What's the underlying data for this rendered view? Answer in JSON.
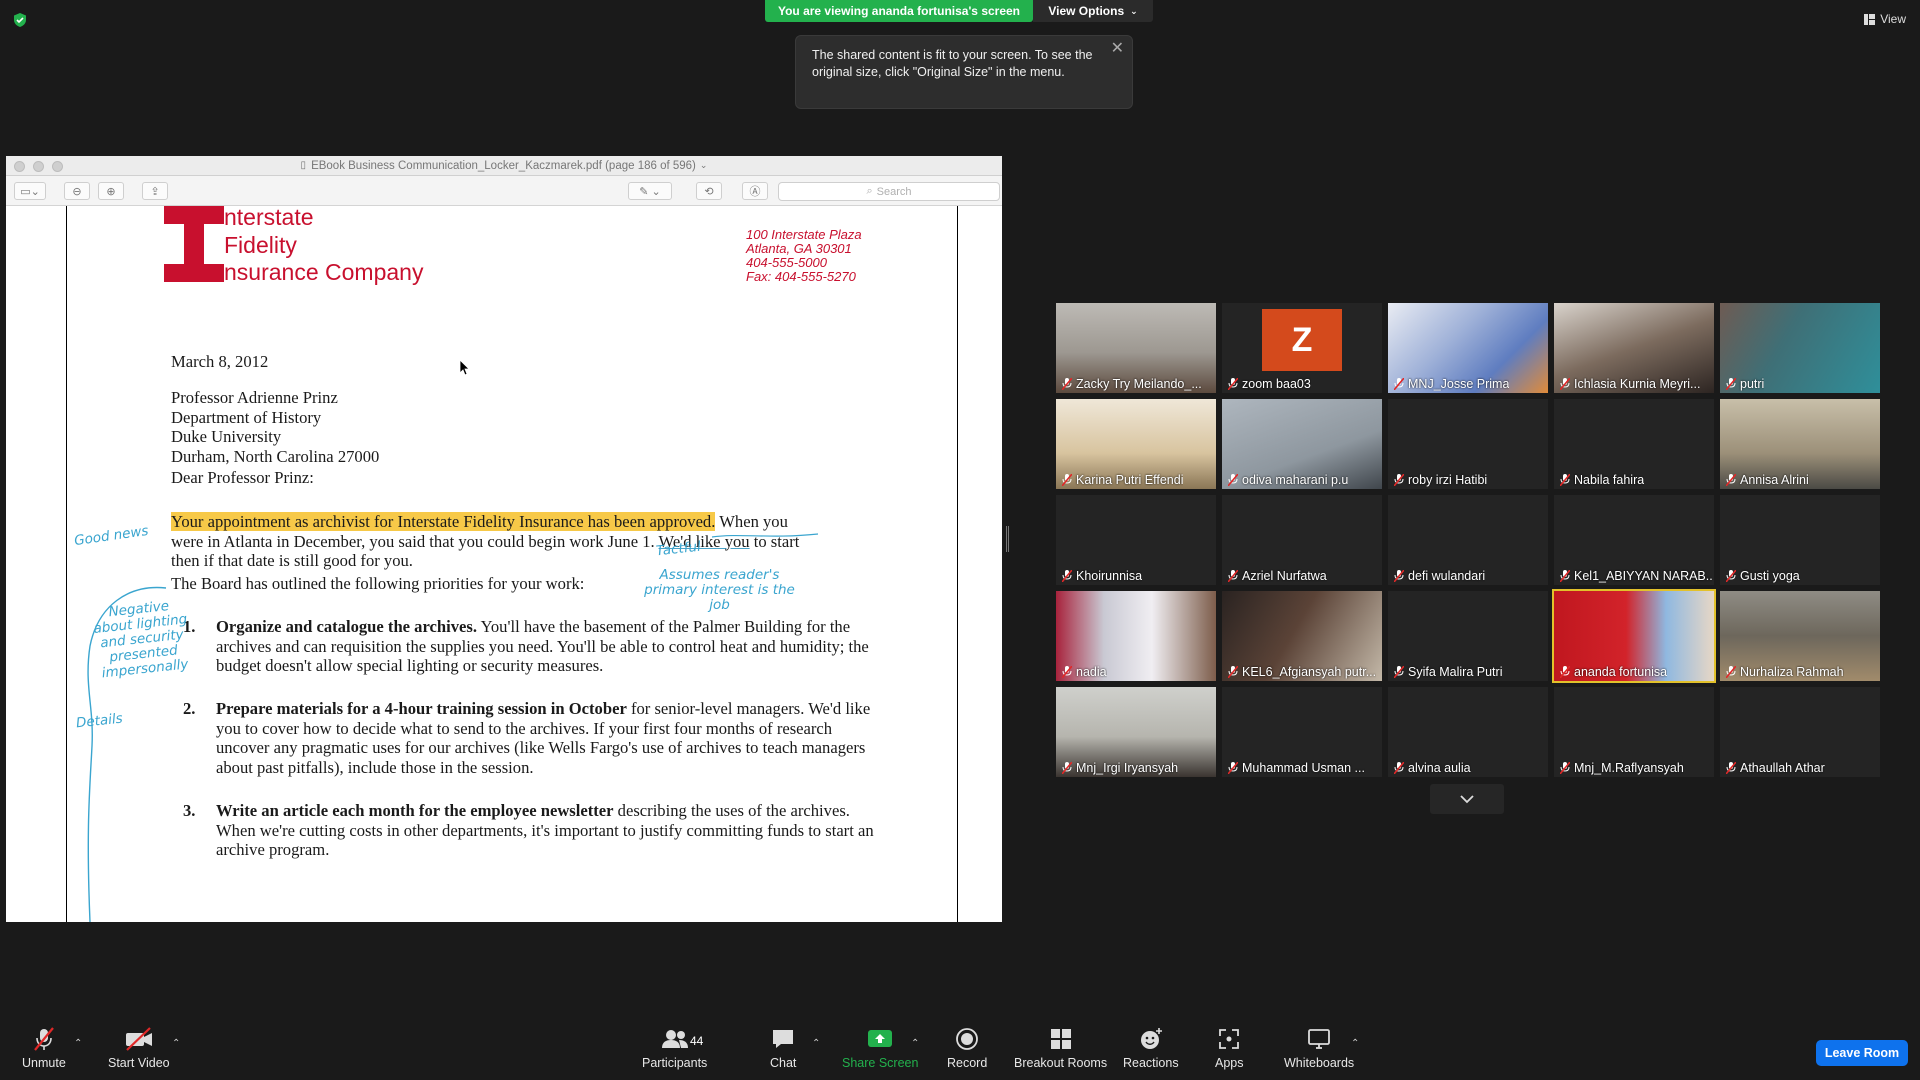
{
  "top": {
    "viewing_banner": "You are viewing ananda fortunisa's screen",
    "view_options": "View Options",
    "view_label": "View",
    "tooltip_text": "The shared content is fit to your screen. To see the original size, click \"Original Size\" in the menu."
  },
  "viewer": {
    "window_title": "EBook Business Communication_Locker_Kaczmarek.pdf (page 186 of 596)",
    "search_placeholder": "Search"
  },
  "letter": {
    "logo_line1": "nterstate",
    "logo_line2": "Fidelity",
    "logo_line3": "nsurance Company",
    "address1": "100 Interstate Plaza",
    "address2": "Atlanta, GA 30301",
    "address3": "404-555-5000",
    "address4": "Fax:  404-555-5270",
    "date": "March 8, 2012",
    "recipient1": "Professor Adrienne Prinz",
    "recipient2": "Department of History",
    "recipient3": "Duke University",
    "recipient4": "Durham, North Carolina  27000",
    "salutation": "Dear Professor Prinz:",
    "p1_highlight": "Your appointment as archivist for Interstate Fidelity Insurance has been approved.",
    "p1_rest_a": " When you",
    "p1_line2a": "were in Atlanta in December, you said that you could begin work June 1.",
    "p1_line2b": "We'd like you",
    "p1_line2c": " to start",
    "p1_line3": "then if that date is still good for you.",
    "p2": "The Board has outlined the following priorities for your work:",
    "item1_num": "1.",
    "item1_bold": "Organize and catalogue the archives.",
    "item1_rest": " You'll have the basement of the Palmer Building for the archives and can requisition the supplies you need.  You'll be able to control heat and humidity; the budget doesn't allow special lighting or security measures.",
    "item2_num": "2.",
    "item2_bold": "Prepare materials for a 4-hour training session in October",
    "item2_rest": " for senior-level managers. We'd like you to cover how to decide what to send to the archives.  If your first four months of research uncover any pragmatic uses for our archives (like Wells Fargo's use of archives to teach managers about past pitfalls), include those in the session.",
    "item3_num": "3.",
    "item3_bold": "Write an article each month for the employee newsletter",
    "item3_rest": " describing the uses of the archives. When we're cutting costs in other departments, it's important to justify committing funds to start an archive program.",
    "anno_good_news": "Good news",
    "anno_tactful": "Tactful",
    "anno_assumes": "Assumes reader's primary interest is the job",
    "anno_negative": "Negative about lighting and security presented impersonally",
    "anno_details": "Details"
  },
  "participants": [
    "Zacky Try Meilando_...",
    "zoom baa03",
    "MNJ_Josse Prima",
    "Ichlasia Kurnia Meyri...",
    "putri",
    "Karina Putri Effendi",
    "odiva maharani p.u",
    "roby irzi Hatibi",
    "Nabila fahira",
    "Annisa Alrini",
    "Khoirunnisa",
    "Azriel Nurfatwa",
    "defi wulandari",
    "Kel1_ABIYYAN NARAB...",
    "Gusti yoga",
    "nadia",
    "KEL6_Afgiansyah putr...",
    "Syifa Malira Putri",
    "ananda fortunisa",
    "Nurhaliza Rahmah",
    "Mnj_Irgi Iryansyah",
    "Muhammad Usman ...",
    "alvina aulia",
    "Mnj_M.Raflyansyah",
    "Athaullah Athar"
  ],
  "avatar_letter": "Z",
  "controls": {
    "unmute": "Unmute",
    "start_video": "Start Video",
    "participants": "Participants",
    "participants_count": "44",
    "chat": "Chat",
    "share_screen": "Share Screen",
    "record": "Record",
    "breakout_rooms": "Breakout Rooms",
    "reactions": "Reactions",
    "apps": "Apps",
    "whiteboards": "Whiteboards",
    "leave_room": "Leave Room"
  },
  "colors": {
    "banner_green": "#23b14d",
    "leave_blue": "#0e72ed",
    "logo_red": "#c8102e",
    "highlight": "#f7c948",
    "annotation": "#3aa5cf"
  }
}
